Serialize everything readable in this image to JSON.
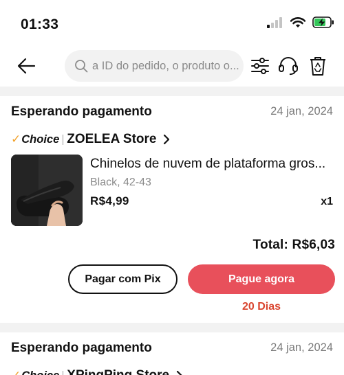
{
  "status_bar": {
    "time": "01:33"
  },
  "search": {
    "placeholder": "a ID do pedido, o produto o..."
  },
  "orders": [
    {
      "status": "Esperando pagamento",
      "date": "24 jan, 2024",
      "choice_label": "Choice",
      "store": "ZOELEA Store",
      "product_title": "Chinelos de nuvem de plataforma gros...",
      "variant": "Black, 42-43",
      "price": "R$4,99",
      "quantity": "x1",
      "total": "Total: R$6,03",
      "pix_button": "Pagar com Pix",
      "pay_button": "Pague agora",
      "countdown": "20 Dias"
    },
    {
      "status": "Esperando pagamento",
      "date": "24 jan, 2024",
      "choice_label": "Choice",
      "store": "XPingPing Store"
    }
  ],
  "colors": {
    "accent": "#e8505b",
    "countdown": "#d9452f",
    "choice": "#f2a22b",
    "divider": "#f2f2f2"
  }
}
